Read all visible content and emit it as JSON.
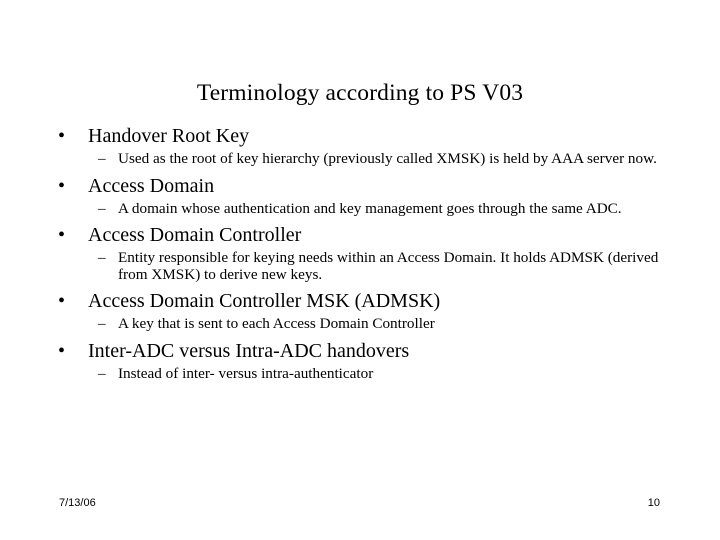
{
  "slide": {
    "title": "Terminology according to PS V03",
    "bullet_marker": "•",
    "sub_bullet_marker": "–",
    "content": [
      {
        "heading": "Handover Root Key",
        "details": [
          "Used as the root of key hierarchy (previously called XMSK) is held by AAA server now."
        ]
      },
      {
        "heading": "Access Domain",
        "details": [
          "A domain whose authentication and key management goes through the same ADC."
        ]
      },
      {
        "heading": "Access Domain Controller",
        "details": [
          "Entity responsible for keying needs within an Access Domain. It holds ADMSK  (derived from XMSK) to derive new keys."
        ]
      },
      {
        "heading": "Access Domain Controller MSK (ADMSK)",
        "details": [
          "A key that is sent to each Access Domain Controller"
        ]
      },
      {
        "heading": "Inter-ADC versus Intra-ADC handovers",
        "details": [
          "Instead of inter- versus intra-authenticator"
        ]
      }
    ]
  },
  "footer": {
    "date": "7/13/06",
    "page_number": "10"
  },
  "colors": {
    "background": "#ffffff",
    "text": "#000000"
  }
}
